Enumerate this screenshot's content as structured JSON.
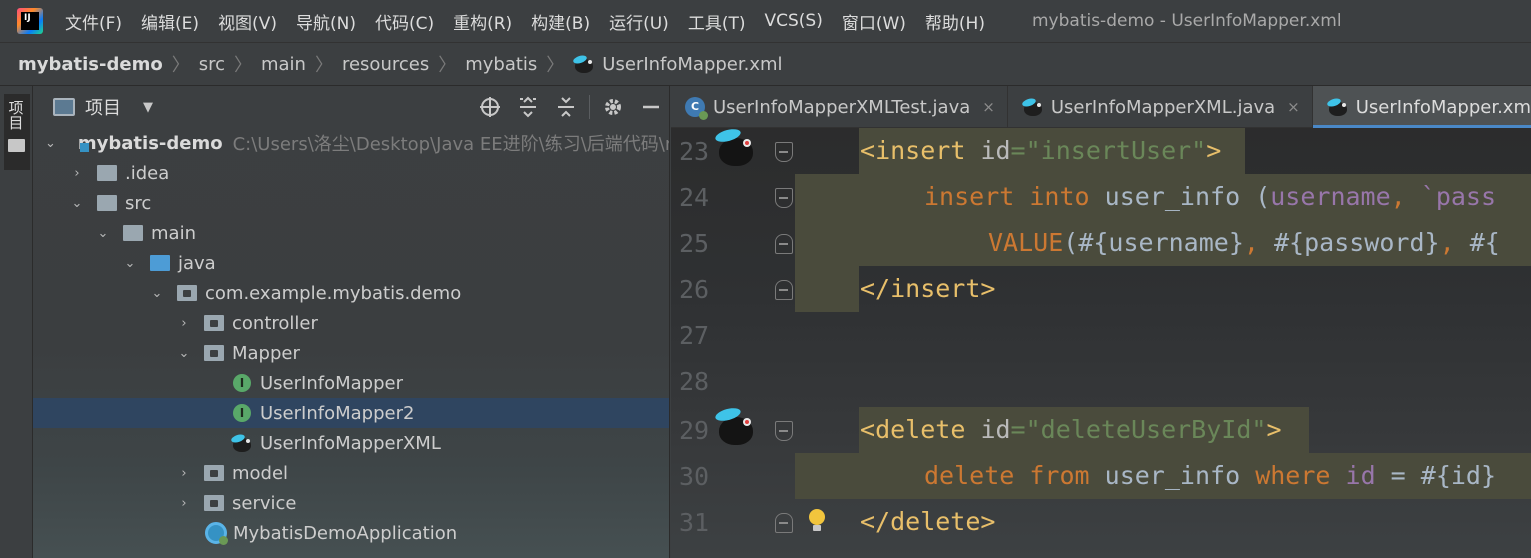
{
  "app": {
    "logo_text": "IJ",
    "window_title": "mybatis-demo - UserInfoMapper.xml"
  },
  "menu": [
    "文件(F)",
    "编辑(E)",
    "视图(V)",
    "导航(N)",
    "代码(C)",
    "重构(R)",
    "构建(B)",
    "运行(U)",
    "工具(T)",
    "VCS(S)",
    "窗口(W)",
    "帮助(H)"
  ],
  "breadcrumb": [
    "mybatis-demo",
    "src",
    "main",
    "resources",
    "mybatis",
    "UserInfoMapper.xml"
  ],
  "toolstrip": {
    "project_label": "项目"
  },
  "project_panel": {
    "title": "项目",
    "tree": [
      {
        "label": "mybatis-demo",
        "path": "C:\\Users\\洛尘\\Desktop\\Java EE进阶\\练习\\后端代码\\m",
        "icon": "module-folder-icon",
        "expanded": true
      },
      {
        "label": ".idea",
        "icon": "folder-icon",
        "expanded": false
      },
      {
        "label": "src",
        "icon": "folder-icon",
        "expanded": true
      },
      {
        "label": "main",
        "icon": "folder-icon",
        "expanded": true
      },
      {
        "label": "java",
        "icon": "source-folder-icon",
        "expanded": true
      },
      {
        "label": "com.example.mybatis.demo",
        "icon": "package-icon",
        "expanded": true
      },
      {
        "label": "controller",
        "icon": "package-icon",
        "expanded": false
      },
      {
        "label": "Mapper",
        "icon": "package-icon",
        "expanded": true
      },
      {
        "label": "UserInfoMapper",
        "icon": "interface-icon"
      },
      {
        "label": "UserInfoMapper2",
        "icon": "interface-icon",
        "selected": true
      },
      {
        "label": "UserInfoMapperXML",
        "icon": "mybatis-icon"
      },
      {
        "label": "model",
        "icon": "package-icon",
        "expanded": false
      },
      {
        "label": "service",
        "icon": "package-icon",
        "expanded": false
      },
      {
        "label": "MybatisDemoApplication",
        "icon": "spring-boot-icon"
      }
    ]
  },
  "tabs": [
    {
      "label": "UserInfoMapperXMLTest.java",
      "icon": "java-class-icon",
      "close": "×"
    },
    {
      "label": "UserInfoMapperXML.java",
      "icon": "mybatis-icon",
      "close": "×"
    },
    {
      "label": "UserInfoMapper.xml",
      "icon": "mybatis-icon",
      "active": true,
      "close": "×"
    }
  ],
  "code": {
    "line_numbers": [
      "23",
      "24",
      "25",
      "26",
      "27",
      "28",
      "29",
      "30",
      "31"
    ],
    "l23": {
      "open": "<",
      "tag": "insert",
      "sp": " ",
      "attr": "id",
      "eq": "=",
      "val": "\"insertUser\"",
      "close": ">"
    },
    "l24": {
      "kw1": "insert",
      "sp1": " ",
      "kw2": "into",
      "sp2": " ",
      "tbl": "user_info",
      "sp3": " ",
      "paren": "(",
      "f1": "username",
      "comma": ", ",
      "f2": "`pass"
    },
    "l25": {
      "kw": "VALUE",
      "rest": "(#{username}",
      "c1": ", ",
      "p2": "#{password}",
      "c2": ", ",
      "p3": "#{"
    },
    "l26": {
      "text": "</insert>"
    },
    "l29": {
      "open": "<",
      "tag": "delete",
      "sp": " ",
      "attr": "id",
      "eq": "=",
      "val": "\"deleteUserById\"",
      "close": ">"
    },
    "l30": {
      "kw1": "delete",
      "sp1": " ",
      "kw2": "from",
      "sp2": " ",
      "tbl": "user_info",
      "sp3": " ",
      "kw3": "where",
      "sp4": " ",
      "field": "id",
      "eq": " = ",
      "param": "#{id}"
    },
    "l31": {
      "text": "</delete>"
    }
  },
  "colors": {
    "selection": "#2f4560",
    "tag": "#e8bf6a",
    "string": "#6a8759",
    "keyword": "#cc7832",
    "field": "#9876aa",
    "tab_underline": "#4a88c7"
  }
}
